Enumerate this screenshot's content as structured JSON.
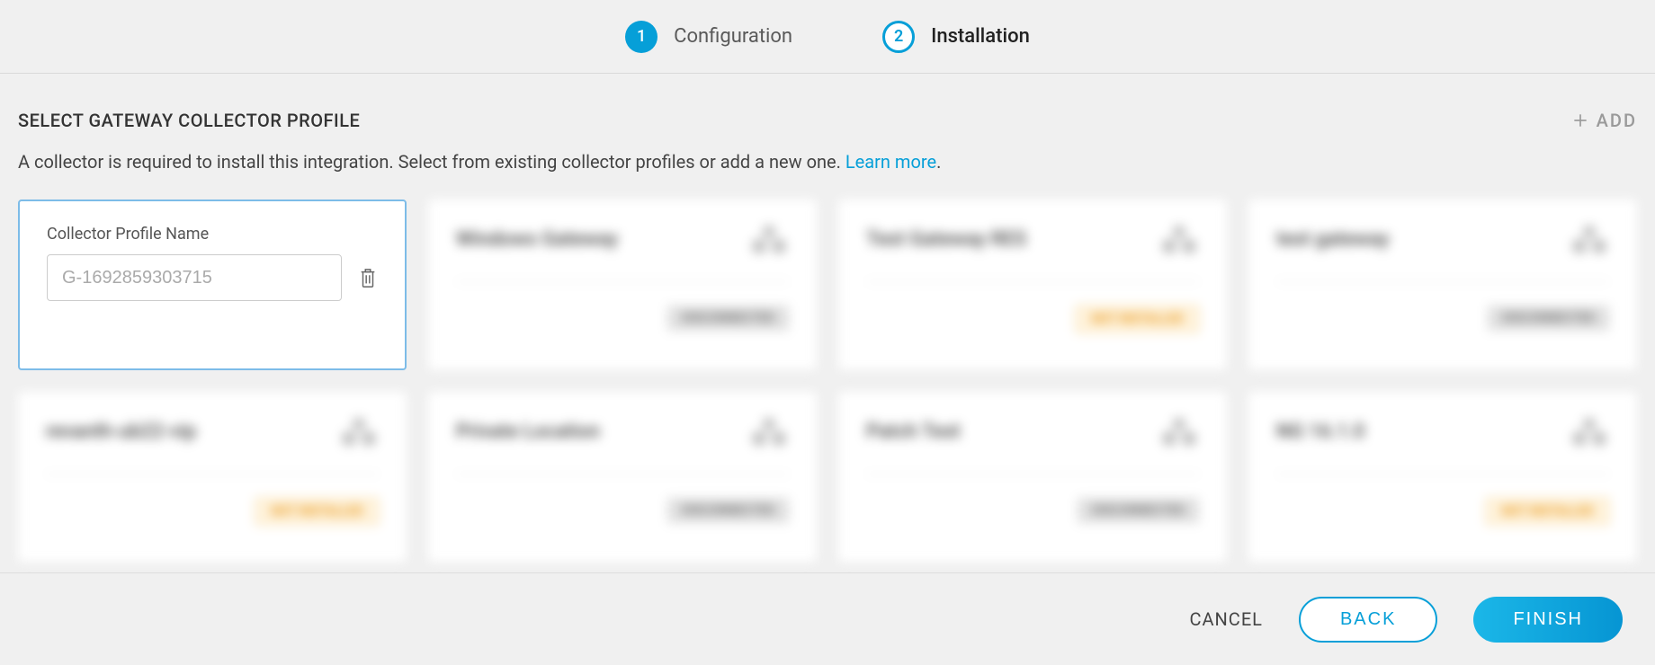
{
  "stepper": {
    "steps": [
      {
        "num": "1",
        "label": "Configuration",
        "state": "done"
      },
      {
        "num": "2",
        "label": "Installation",
        "state": "active"
      }
    ]
  },
  "section": {
    "title": "SELECT GATEWAY COLLECTOR PROFILE",
    "add_label": "ADD",
    "description_prefix": "A collector is required to install this integration. Select from existing collector profiles or add a new one. ",
    "learn_more": "Learn more",
    "description_suffix": "."
  },
  "new_profile": {
    "field_label": "Collector Profile Name",
    "placeholder": "G-1692859303715"
  },
  "cards": [
    {
      "title": "Windows Gateway",
      "status": "DISCONNECTED",
      "status_kind": "gray"
    },
    {
      "title": "Test Gateway RES",
      "status": "NOT INSTALLED",
      "status_kind": "warn"
    },
    {
      "title": "test gateway",
      "status": "DISCONNECTED",
      "status_kind": "gray"
    },
    {
      "title": "revanth-ub22-vip",
      "status": "NOT INSTALLED",
      "status_kind": "warn"
    },
    {
      "title": "Private Location",
      "status": "DISCONNECTED",
      "status_kind": "gray"
    },
    {
      "title": "Patch Test",
      "status": "DISCONNECTED",
      "status_kind": "gray"
    },
    {
      "title": "NG 16.1.0",
      "status": "NOT INSTALLED",
      "status_kind": "warn"
    }
  ],
  "footer": {
    "cancel": "CANCEL",
    "back": "BACK",
    "finish": "FINISH"
  }
}
